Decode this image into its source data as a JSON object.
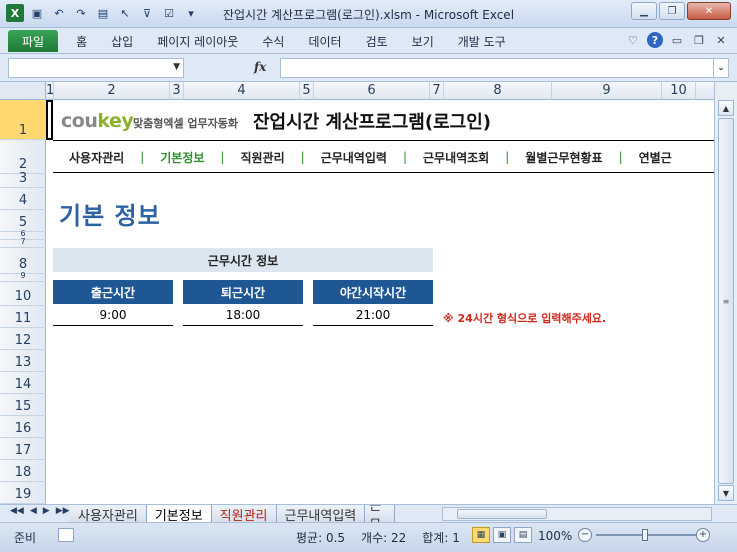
{
  "window": {
    "title": "잔업시간 계산프로그램(로그인).xlsm  -  Microsoft Excel"
  },
  "ribbon": {
    "tabs": [
      "파일",
      "홈",
      "삽입",
      "페이지 레이아웃",
      "수식",
      "데이터",
      "검토",
      "보기",
      "개발 도구"
    ]
  },
  "formula_bar": {
    "name_box_value": "",
    "formula_value": ""
  },
  "columns": [
    "1",
    "2",
    "3",
    "4",
    "5",
    "6",
    "7",
    "8",
    "9",
    "10"
  ],
  "rows": [
    "1",
    "2",
    "3",
    "4",
    "5",
    "6",
    "7",
    "8",
    "9",
    "10",
    "11",
    "12",
    "13",
    "14",
    "15",
    "16",
    "17",
    "18",
    "19"
  ],
  "sheet": {
    "logo_text": "cou",
    "logo_key": "key",
    "logo_sub": "맞춤형엑셀 업무자동화",
    "title": "잔업시간 계산프로그램(로그인)",
    "menu": [
      "사용자관리",
      "기본정보",
      "직원관리",
      "근무내역입력",
      "근무내역조회",
      "월별근무현황표",
      "연별근"
    ],
    "menu_active_index": 1,
    "heading": "기본 정보",
    "section_title": "근무시간 정보",
    "fields": [
      {
        "label": "출근시간",
        "value": "9:00"
      },
      {
        "label": "퇴근시간",
        "value": "18:00"
      },
      {
        "label": "야간시작시간",
        "value": "21:00"
      }
    ],
    "note": "※ 24시간 형식으로 입력해주세요."
  },
  "sheet_tabs": [
    "사용자관리",
    "기본정보",
    "직원관리",
    "근무내역입력",
    "근무"
  ],
  "active_sheet_index": 1,
  "status": {
    "ready": "준비",
    "average": "평균: 0.5",
    "count": "개수: 22",
    "sum": "합계: 1",
    "zoom": "100%"
  },
  "colors": {
    "heading_blue": "#2d63a6",
    "field_header_bg": "#1f5795",
    "section_bg": "#dce6f0",
    "note_red": "#d0281c",
    "menu_active_green": "#2f8f2f"
  }
}
